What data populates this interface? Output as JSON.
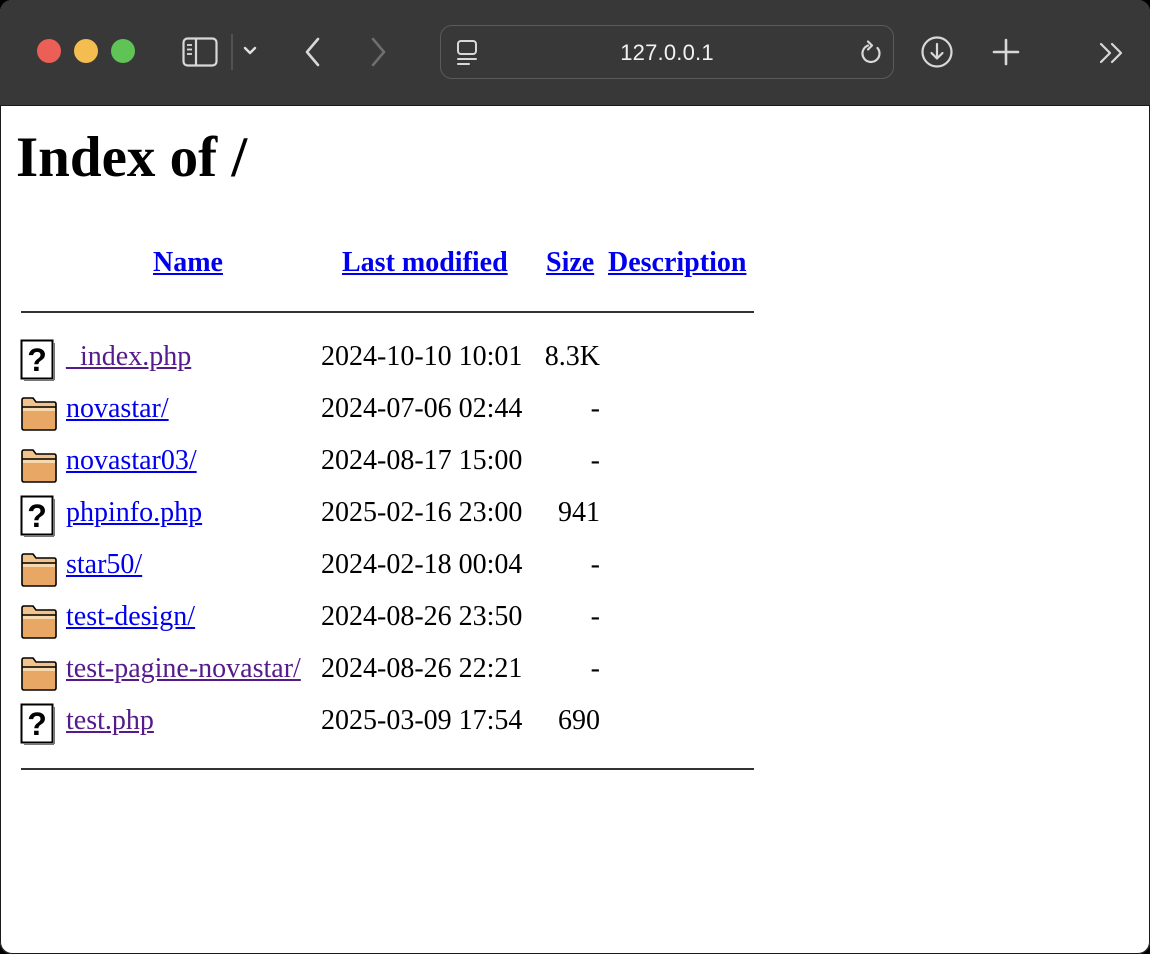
{
  "browser": {
    "address": "127.0.0.1"
  },
  "page": {
    "title": "Index of /",
    "columns": {
      "name": "Name",
      "last_modified": "Last modified",
      "size": "Size",
      "description": "Description"
    },
    "entries": [
      {
        "name": "_index.php",
        "modified": "2024-10-10 10:01",
        "size": "8.3K",
        "kind": "file",
        "visited": true
      },
      {
        "name": "novastar/",
        "modified": "2024-07-06 02:44",
        "size": "-",
        "kind": "folder",
        "visited": false
      },
      {
        "name": "novastar03/",
        "modified": "2024-08-17 15:00",
        "size": "-",
        "kind": "folder",
        "visited": false
      },
      {
        "name": "phpinfo.php",
        "modified": "2025-02-16 23:00",
        "size": "941",
        "kind": "file",
        "visited": false
      },
      {
        "name": "star50/",
        "modified": "2024-02-18 00:04",
        "size": "-",
        "kind": "folder",
        "visited": false
      },
      {
        "name": "test-design/",
        "modified": "2024-08-26 23:50",
        "size": "-",
        "kind": "folder",
        "visited": false
      },
      {
        "name": "test-pagine-novastar/",
        "modified": "2024-08-26 22:21",
        "size": "-",
        "kind": "folder",
        "visited": true
      },
      {
        "name": "test.php",
        "modified": "2025-03-09 17:54",
        "size": "690",
        "kind": "file",
        "visited": true
      }
    ]
  },
  "colors": {
    "toolbar": "#383838",
    "link": "#0000ee",
    "visited_link": "#551a8b",
    "close": "#ec5f57",
    "minimize": "#f4bd4f",
    "zoom": "#5fc455"
  }
}
